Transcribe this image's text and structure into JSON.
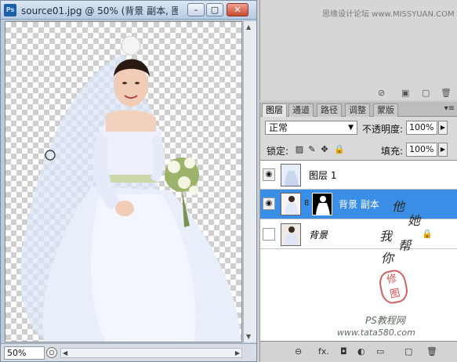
{
  "document": {
    "title": "source01.jpg @ 50% (背景 副本, 图...",
    "zoom": "50%",
    "window_buttons": [
      "–",
      "▢",
      "✕"
    ]
  },
  "top_panel": {
    "watermark": "思缘设计论坛  www.MISSYUAN.COM"
  },
  "layers_panel": {
    "tabs": [
      "图层",
      "通道",
      "路径",
      "调整",
      "蒙版"
    ],
    "active_tab": 0,
    "blend_mode": "正常",
    "opacity_label": "不透明度:",
    "opacity_value": "100%",
    "lock_label": "锁定:",
    "fill_label": "填充:",
    "fill_value": "100%",
    "layers": [
      {
        "name": "图层 1",
        "visible": true,
        "selected": false,
        "locked": false
      },
      {
        "name": "背景 副本",
        "visible": true,
        "selected": true,
        "locked": false
      },
      {
        "name": "背景",
        "visible": false,
        "selected": false,
        "locked": true
      }
    ]
  },
  "handwriting": {
    "lines": [
      "他",
      "她",
      "我",
      "帮",
      "你"
    ]
  },
  "stamp": "修\n图",
  "watermark_bottom": {
    "line1": "PS教程网",
    "line2": "www.tata580.com"
  },
  "colors": {
    "selection": "#3a8ee6",
    "title_gradient_top": "#dce7f3",
    "title_gradient_bottom": "#b7cbe3"
  }
}
